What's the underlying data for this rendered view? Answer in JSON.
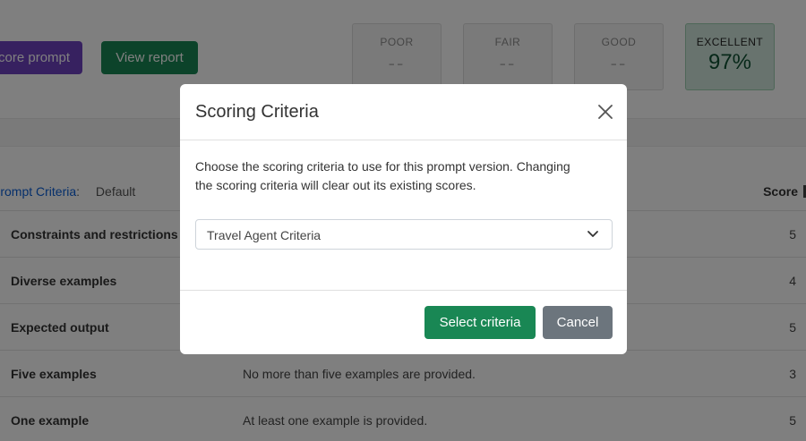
{
  "toolbar": {
    "score_prompt_label": "Score prompt",
    "view_report_label": "View report"
  },
  "score_cards": [
    {
      "label": "POOR",
      "value": "--"
    },
    {
      "label": "FAIR",
      "value": "--"
    },
    {
      "label": "GOOD",
      "value": "--"
    },
    {
      "label": "EXCELLENT",
      "value": "97%"
    }
  ],
  "criteria_header": {
    "lead": "Prompt Criteria",
    "colon": ":",
    "value": "Default",
    "score_label": "Score"
  },
  "rows": [
    {
      "name": "Constraints and restrictions",
      "description": "",
      "score": "5"
    },
    {
      "name": "Diverse examples",
      "description": "",
      "score": "4"
    },
    {
      "name": "Expected output",
      "description": "",
      "score": "5"
    },
    {
      "name": "Five examples",
      "description": "No more than five examples are provided.",
      "score": "3"
    },
    {
      "name": "One example",
      "description": "At least one example is provided.",
      "score": "5"
    }
  ],
  "modal": {
    "title": "Scoring Criteria",
    "body_line1": "Choose the scoring criteria to use for this prompt version. Changing",
    "body_line2": "the scoring criteria will clear out its existing scores.",
    "select_value": "Travel Agent Criteria",
    "select_button_label": "Select criteria",
    "cancel_button_label": "Cancel",
    "close_icon": "close-icon",
    "chevron_icon": "chevron-down-icon"
  },
  "colors": {
    "primary_green": "#198754",
    "purple": "#6f42c1",
    "cancel_gray": "#6c757d",
    "excellent_bg": "#d1e7dd"
  }
}
